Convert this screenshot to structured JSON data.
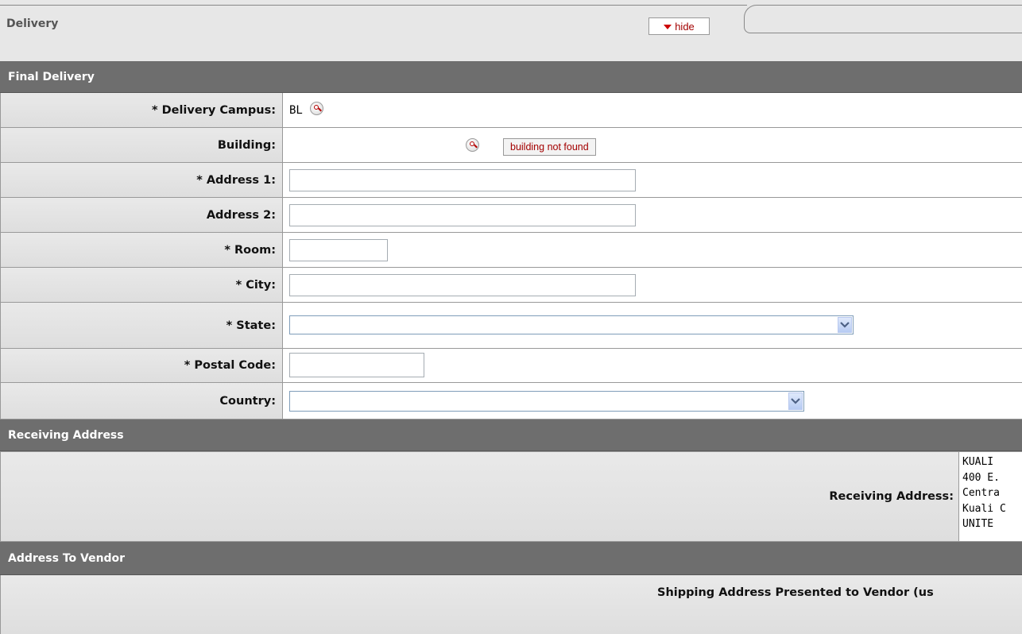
{
  "tab": {
    "title": "Delivery",
    "hide_label": "hide"
  },
  "sections": {
    "final_delivery": "Final Delivery",
    "receiving_address": "Receiving Address",
    "address_to_vendor": "Address To Vendor"
  },
  "fields": {
    "delivery_campus": {
      "label": "* Delivery Campus:",
      "value": "BL"
    },
    "building": {
      "label": "Building:",
      "button": "building not found"
    },
    "address1": {
      "label": "* Address 1:",
      "value": ""
    },
    "address2": {
      "label": "Address 2:",
      "value": ""
    },
    "room": {
      "label": "* Room:",
      "value": ""
    },
    "city": {
      "label": "* City:",
      "value": ""
    },
    "state": {
      "label": "* State:",
      "value": ""
    },
    "postal_code": {
      "label": "* Postal Code:",
      "value": ""
    },
    "country": {
      "label": "Country:",
      "value": ""
    }
  },
  "receiving": {
    "label": "Receiving Address:",
    "lines": [
      "KUALI",
      "400 E.",
      "Centra",
      "Kuali C",
      "UNITE"
    ]
  },
  "vendor": {
    "label": "Shipping Address Presented to Vendor (us"
  },
  "icons": {
    "lookup": "magnifier-lookup-icon",
    "dropdown": "chevron-down-icon",
    "hide": "triangle-down-icon"
  }
}
